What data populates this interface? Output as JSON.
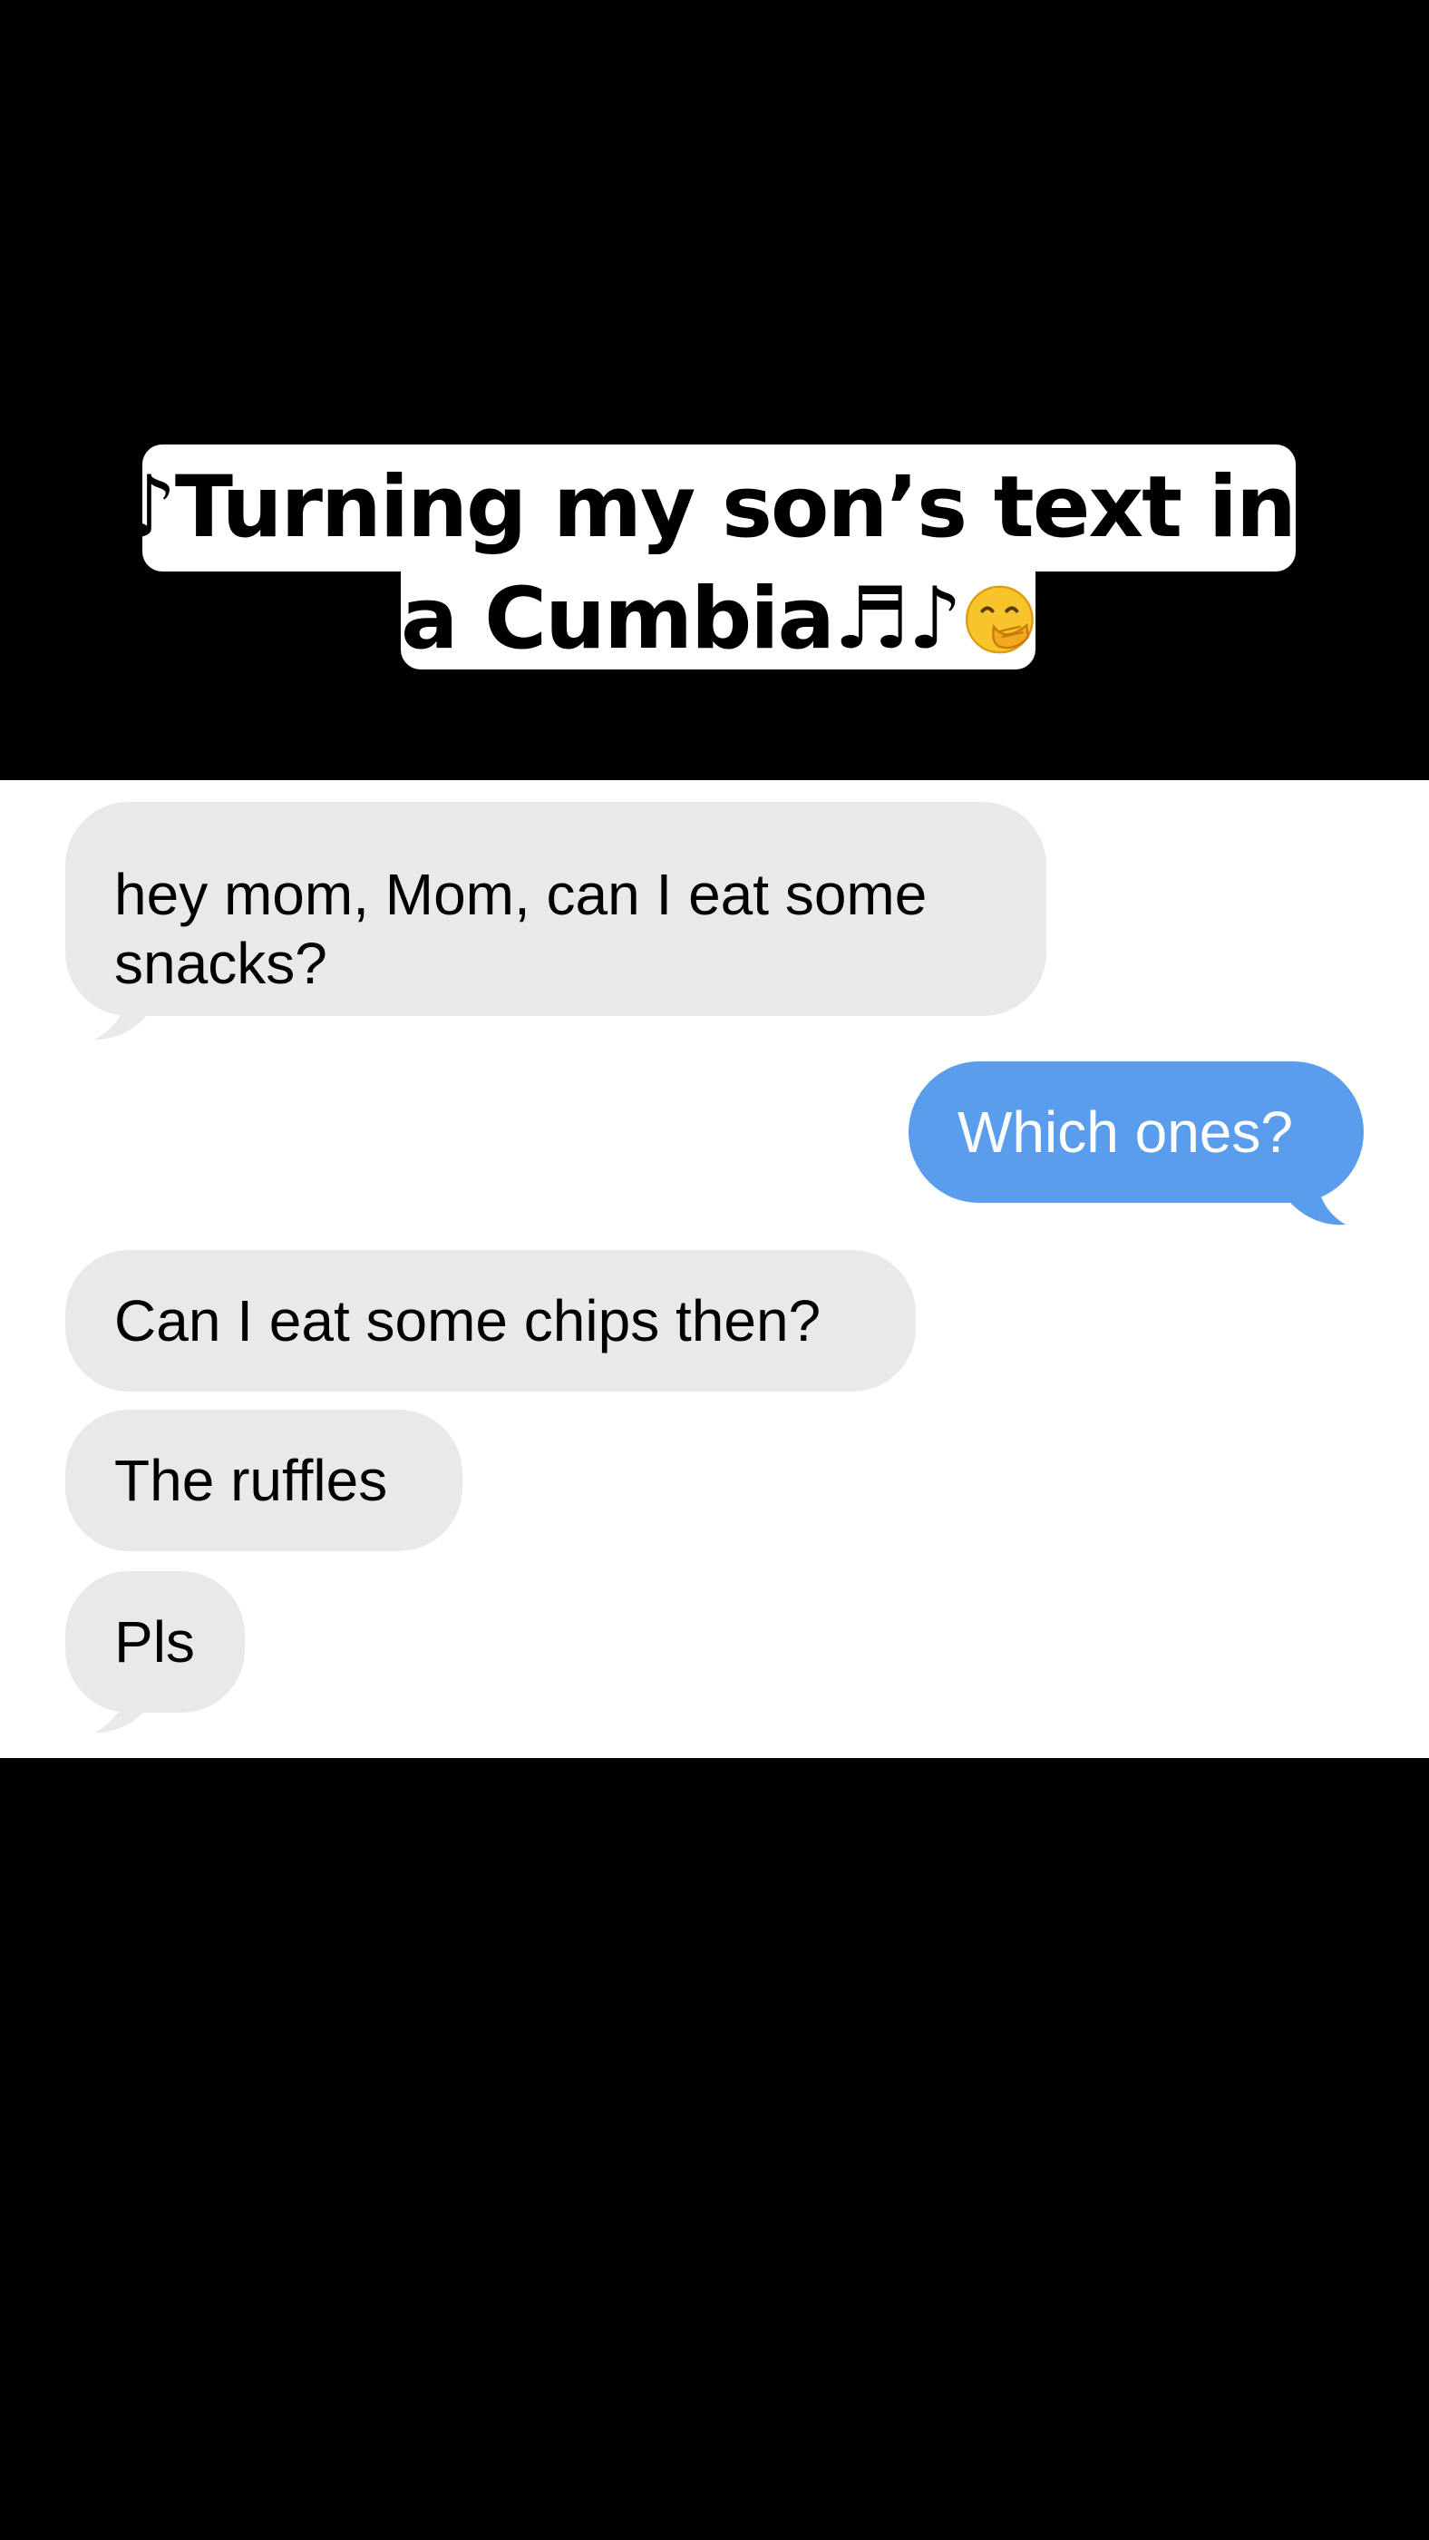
{
  "caption": {
    "line1": "Turning my son’s text into",
    "line2": "a Cumbia ",
    "music_icon": "musical-notes",
    "face_icon": "face-with-hand-over-mouth-emoji"
  },
  "messages": [
    {
      "sender": "incoming",
      "text": "hey mom, Mom, can I eat some snacks?"
    },
    {
      "sender": "outgoing",
      "text": "Which ones?"
    },
    {
      "sender": "incoming",
      "text": "Can I eat some chips then?"
    },
    {
      "sender": "incoming",
      "text": "The ruffles"
    },
    {
      "sender": "incoming",
      "text": "Pls"
    }
  ],
  "colors": {
    "background": "#000000",
    "chat_background": "#ffffff",
    "incoming_bubble": "#e9e9eb",
    "outgoing_bubble": "#5b9ded"
  }
}
